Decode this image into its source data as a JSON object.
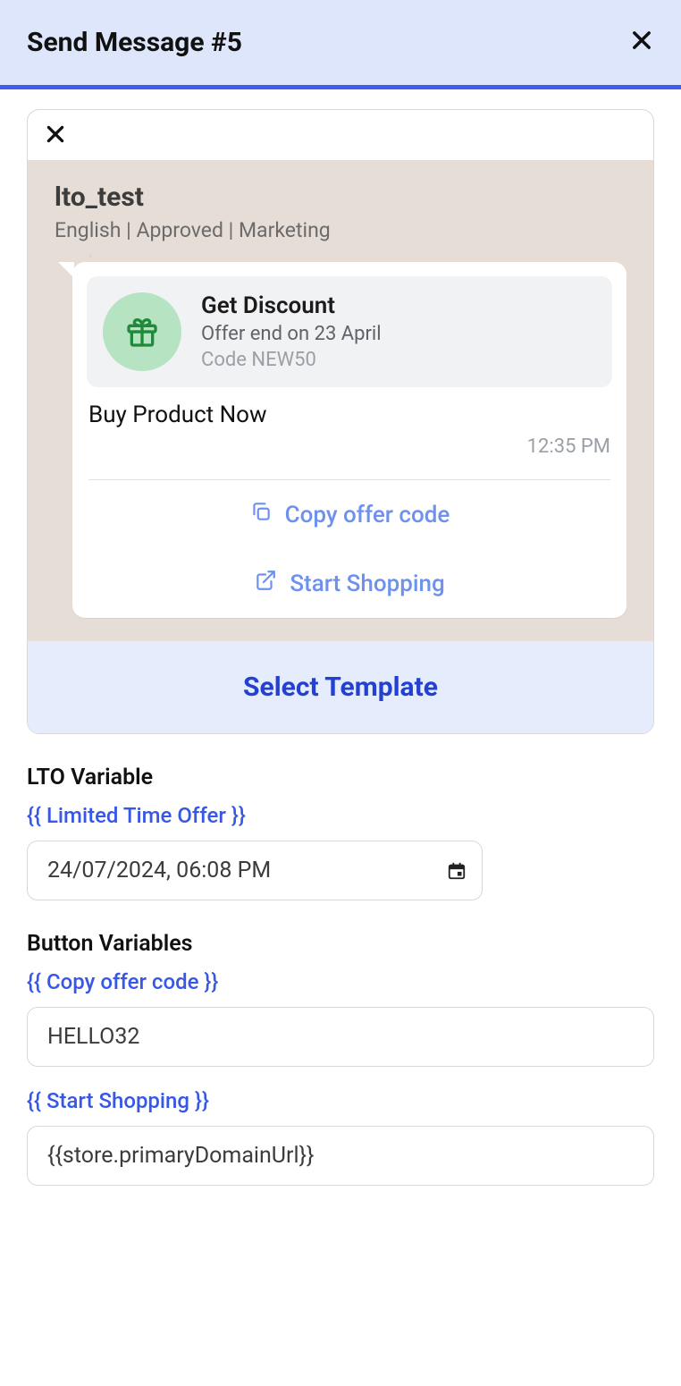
{
  "header": {
    "title": "Send Message #5"
  },
  "template": {
    "name": "lto_test",
    "meta": "English | Approved | Marketing",
    "offer": {
      "title": "Get Discount",
      "subtitle": "Offer end on 23 April",
      "code_line": "Code NEW50"
    },
    "body": "Buy Product Now",
    "timestamp": "12:35 PM",
    "actions": {
      "copy": "Copy offer code",
      "shop": "Start Shopping"
    },
    "select_label": "Select Template"
  },
  "lto": {
    "section_label": "LTO Variable",
    "tag": "{{ Limited Time Offer }}",
    "value": "24/07/2024, 06:08 PM"
  },
  "buttons": {
    "section_label": "Button Variables",
    "copy_tag": "{{ Copy offer code }}",
    "copy_value": "HELLO32",
    "shop_tag": "{{ Start Shopping }}",
    "shop_value": "{{store.primaryDomainUrl}}"
  }
}
